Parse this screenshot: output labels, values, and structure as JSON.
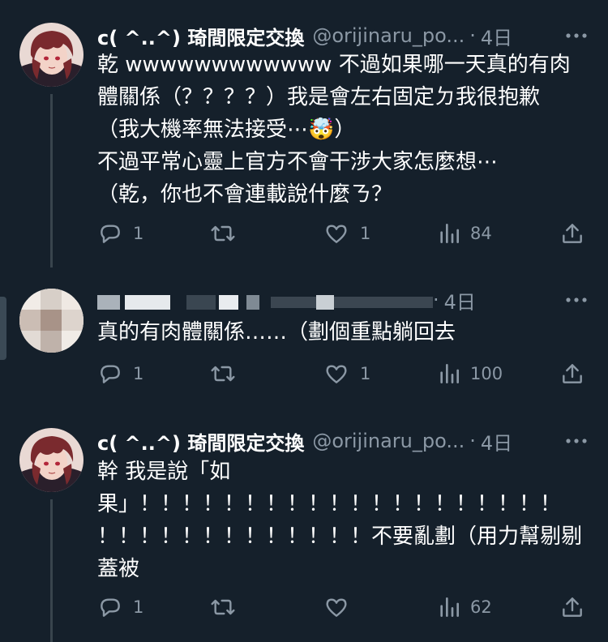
{
  "tweets": [
    {
      "display_name": "c( ^..^) 琦間限定交換",
      "handle": "@orijinaru_po...",
      "separator": "·",
      "time": "4日",
      "lines": [
        "乾 wwwwwwwwwwww 不過如果哪一天真的有肉",
        "體關係（？？？？）我是會左右固定ㄉ我很抱歉",
        "（我大機率無法接受⋯🤯）",
        "不過平常心靈上官方不會干涉大家怎麼想⋯",
        "（乾，你也不會連載說什麼ㄋ？"
      ],
      "replies": "1",
      "retweets": "",
      "likes": "1",
      "views": "84"
    },
    {
      "display_name": "",
      "handle": "",
      "separator": "·",
      "time": "4日",
      "lines": [
        "真的有肉體關係……（劃個重點躺回去"
      ],
      "replies": "1",
      "retweets": "",
      "likes": "1",
      "views": "100"
    },
    {
      "display_name": "c( ^..^) 琦間限定交換",
      "handle": "@orijinaru_po...",
      "separator": "·",
      "time": "4日",
      "lines": [
        "幹 我是說「如",
        "果」！！！！！！！！！！！！！！！！！！！！",
        "！！！！！！！！！！！！！不要亂劃（用力幫剔剔",
        "蓋被"
      ],
      "replies": "1",
      "retweets": "",
      "likes": "",
      "views": "62"
    }
  ],
  "icons": {
    "reply": "reply-icon",
    "retweet": "retweet-icon",
    "like": "heart-icon",
    "views": "views-icon",
    "share": "share-icon",
    "more": "more-icon"
  },
  "colors": {
    "background": "#15202b",
    "text": "#ffffff",
    "secondary": "#8b98a5",
    "thread_line": "#38444d"
  }
}
